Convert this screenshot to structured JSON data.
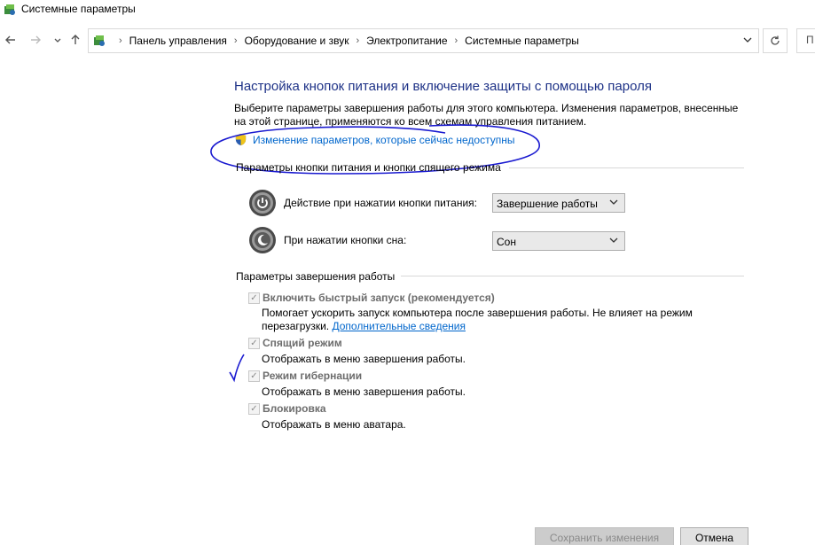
{
  "window": {
    "title": "Системные параметры",
    "app_icon": "control-panel-icon"
  },
  "nav": {
    "back_icon": "arrow-left-icon",
    "forward_icon": "arrow-right-icon",
    "recent_icon": "chevron-down-icon",
    "up_icon": "arrow-up-icon",
    "refresh_icon": "refresh-icon",
    "search_text": "П",
    "breadcrumbs": [
      "Панель управления",
      "Оборудование и звук",
      "Электропитание",
      "Системные параметры"
    ]
  },
  "content": {
    "title": "Настройка кнопок питания и включение защиты с помощью пароля",
    "intro": "Выберите параметры завершения работы для этого компьютера. Изменения параметров, внесенные на этой странице, применяются ко всем схемам управления питанием.",
    "change_link": "Изменение параметров, которые сейчас недоступны",
    "power_group": {
      "header": "Параметры кнопки питания и кнопки спящего режима",
      "rows": [
        {
          "label": "Действие при нажатии кнопки питания:",
          "value": "Завершение работы",
          "icon": "power-button-icon"
        },
        {
          "label": "При нажатии кнопки сна:",
          "value": "Сон",
          "icon": "sleep-button-icon"
        }
      ]
    },
    "shutdown_group": {
      "header": "Параметры завершения работы",
      "fast_startup": {
        "label": "Включить быстрый запуск (рекомендуется)",
        "desc": "Помогает ускорить запуск компьютера после завершения работы. Не влияет на режим перезагрузки.",
        "more_link": "Дополнительные сведения",
        "checked": true
      },
      "sleep": {
        "label": "Спящий режим",
        "desc": "Отображать в меню завершения работы.",
        "checked": true
      },
      "hibernate": {
        "label": "Режим гибернации",
        "desc": "Отображать в меню завершения работы.",
        "checked": true
      },
      "lock": {
        "label": "Блокировка",
        "desc": "Отображать в меню аватара.",
        "checked": true
      }
    }
  },
  "footer": {
    "save_label": "Сохранить изменения",
    "cancel_label": "Отмена"
  },
  "colors": {
    "title_blue": "#1e3287",
    "link_blue": "#0066cc",
    "annotation_ink": "#1a1ad0"
  }
}
